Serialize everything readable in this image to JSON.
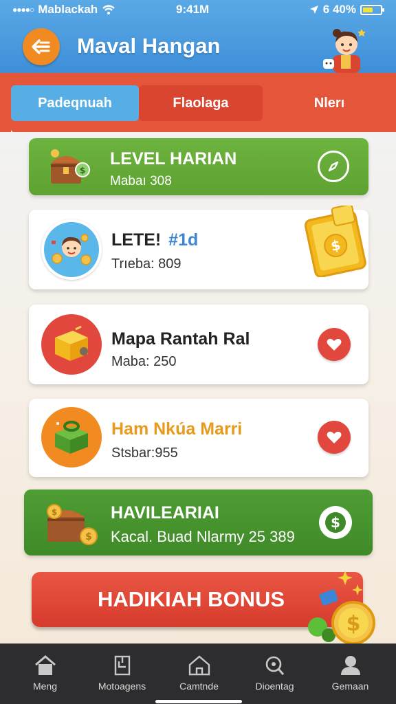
{
  "statusbar": {
    "carrier": "Mablackah",
    "time": "9:41M",
    "battery": "6 40%"
  },
  "header": {
    "title": "Maval Hangan"
  },
  "tabs": [
    {
      "label": "Padeqnuah"
    },
    {
      "label": "Flaolaga"
    },
    {
      "label": "Nlerı"
    }
  ],
  "cards": [
    {
      "title": "LEVEL HARIAN",
      "sub": "Mabaı 308"
    },
    {
      "title": "LETE!",
      "title_extra": "#1d",
      "sub": "Trıeba: 809"
    },
    {
      "title": "Mapa Rantah Ral",
      "sub": "Maba: 250"
    },
    {
      "title": "Ham Nkúa Marri",
      "sub": "Stsbar:955"
    },
    {
      "title": "HAVILEARIAI",
      "sub": "Kacal. Buad Nlarmy 25 389"
    }
  ],
  "bonus_button": {
    "label": "HADIKIAH BONUS"
  },
  "bottom_nav": [
    {
      "label": "Meng",
      "icon": "home-icon"
    },
    {
      "label": "Motoagens",
      "icon": "inbox-icon"
    },
    {
      "label": "Camtnde",
      "icon": "house-outline-icon"
    },
    {
      "label": "Dioentag",
      "icon": "search-icon"
    },
    {
      "label": "Gemaan",
      "icon": "profile-icon"
    }
  ],
  "colors": {
    "header_blue": "#4a9ce0",
    "tab_red": "#e5553a",
    "green_card": "#66ab38",
    "orange_accent": "#f28a22",
    "bonus_red": "#e04a39"
  }
}
